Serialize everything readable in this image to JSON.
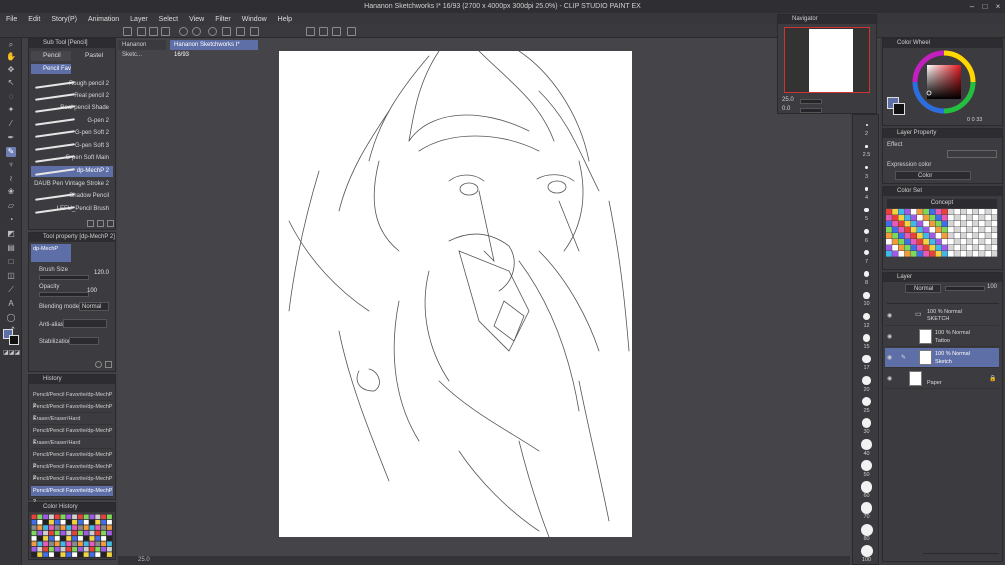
{
  "window": {
    "title": "Hananon Sketchworks I* 16/93 (2700 x 4000px 300dpi 25.0%) - CLIP STUDIO PAINT EX",
    "controls": [
      "–",
      "□",
      "×"
    ]
  },
  "menu": [
    "File",
    "Edit",
    "Story(P)",
    "Animation",
    "Layer",
    "Select",
    "View",
    "Filter",
    "Window",
    "Help"
  ],
  "subtool": {
    "header": "Sub Tool [Pencil]",
    "tabs": [
      "Pencil",
      "Pastel"
    ],
    "group": "Pencil Fav",
    "brushes": [
      {
        "name": "Rough pencil 2",
        "selected": false
      },
      {
        "name": "Real pencil 2",
        "selected": false
      },
      {
        "name": "Real pencil Shade",
        "selected": false
      },
      {
        "name": "G-pen 2",
        "selected": false
      },
      {
        "name": "G-pen Soft 2",
        "selected": false
      },
      {
        "name": "G-pen Soft 3",
        "selected": false
      },
      {
        "name": "G-pen Soft Main",
        "selected": false
      },
      {
        "name": "dp-MechP 2",
        "selected": true
      },
      {
        "name": "DAUB Pen Vintage Stroke 2",
        "selected": false
      },
      {
        "name": "Shadow Pencil",
        "selected": false
      },
      {
        "name": "LEFU_Pencil Brush",
        "selected": false
      }
    ]
  },
  "toolprop": {
    "header": "Tool property [dp-MechP 2]",
    "preset": "dp-MechP",
    "brush_size_label": "Brush Size",
    "brush_size_value": "120.0",
    "opacity_label": "Opacity",
    "opacity_value": "100",
    "blending_label": "Blending mode",
    "blending_value": "Normal",
    "antialias_label": "Anti-alias",
    "stabilization_label": "Stabilization"
  },
  "history": {
    "header": "History",
    "items": [
      {
        "text": "Pencil/Pencil Favorite/dp-MechP 2",
        "selected": false
      },
      {
        "text": "Pencil/Pencil Favorite/dp-MechP 2",
        "selected": false
      },
      {
        "text": "Eraser/Eraser/Hard",
        "selected": false
      },
      {
        "text": "Pencil/Pencil Favorite/dp-MechP 2",
        "selected": false
      },
      {
        "text": "Eraser/Eraser/Hard",
        "selected": false
      },
      {
        "text": "Pencil/Pencil Favorite/dp-MechP 2",
        "selected": false
      },
      {
        "text": "Pencil/Pencil Favorite/dp-MechP 2",
        "selected": false
      },
      {
        "text": "Pencil/Pencil Favorite/dp-MechP 2",
        "selected": false
      },
      {
        "text": "Pencil/Pencil Favorite/dp-MechP 2",
        "selected": true
      }
    ]
  },
  "colorhistory": {
    "header": "Color History"
  },
  "documents": {
    "tabs": [
      {
        "label": "Hananon Sketc...",
        "active": false
      },
      {
        "label": "Hananon Sketchworks I* 16/93",
        "active": true
      }
    ]
  },
  "status": {
    "zoom": "25.0"
  },
  "brushsizes": [
    "2",
    "2.5",
    "3",
    "4",
    "5",
    "6",
    "7",
    "8",
    "10",
    "12",
    "15",
    "17",
    "20",
    "25",
    "30",
    "40",
    "50",
    "60",
    "70",
    "80",
    "100"
  ],
  "navigator": {
    "header": "Navigator",
    "zoom": "25.0",
    "angle": "0.0"
  },
  "colorwheel": {
    "header": "Color Wheel",
    "values": [
      "0",
      "0",
      "33"
    ]
  },
  "layerprop": {
    "header": "Layer Property",
    "effect_label": "Effect",
    "expression_label": "Expression color",
    "expression_value": "Color"
  },
  "colorset": {
    "header": "Color Set",
    "name": "Concept"
  },
  "layers": {
    "header": "Layer",
    "blend": "Normal",
    "opacity": "100",
    "items": [
      {
        "mode": "100 % Normal",
        "name": "SKETCH",
        "type": "folder",
        "selected": false
      },
      {
        "mode": "100 % Normal",
        "name": "Tattoo",
        "type": "layer",
        "selected": false
      },
      {
        "mode": "100 % Normal",
        "name": "Sketch",
        "type": "layer",
        "selected": true
      },
      {
        "mode": "",
        "name": "Paper",
        "type": "paper",
        "selected": false
      }
    ]
  },
  "colors": {
    "accent": "#5e6ea6",
    "panel": "#3b3b40",
    "canvas_bg": "#444449",
    "paper": "#ffffff"
  }
}
